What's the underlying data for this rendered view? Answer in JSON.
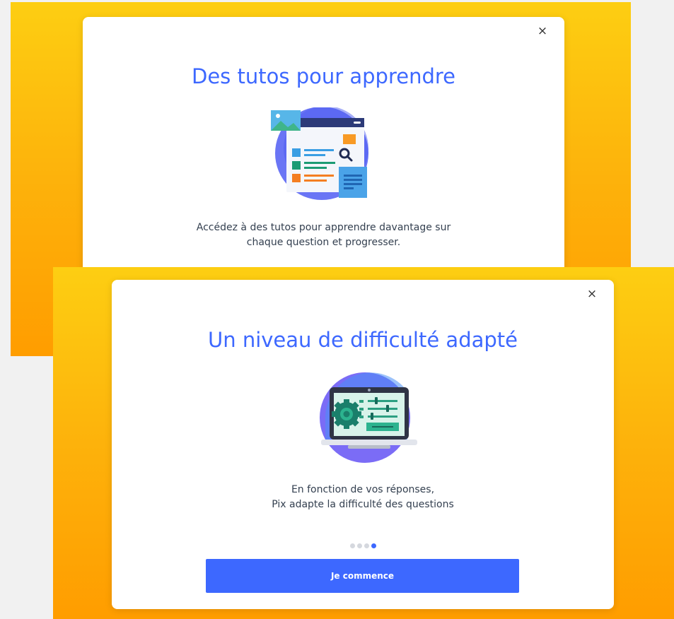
{
  "modal_back": {
    "close_label": "×",
    "title": "Des tutos pour apprendre",
    "illustration_icon": "tutorial-search-illustration",
    "text_lines": [
      "Accédez à des tutos pour apprendre davantage sur",
      "chaque question et progresser."
    ]
  },
  "modal_front": {
    "close_label": "×",
    "title": "Un niveau de difficulté adapté",
    "illustration_icon": "laptop-settings-illustration",
    "text_lines": [
      "En fonction de vos réponses,",
      "Pix adapte la difficulté des questions"
    ],
    "pagination": {
      "total": 4,
      "current": 4
    },
    "button_label": "Je commence"
  },
  "colors": {
    "accent": "#3d68ff",
    "background_gradient_top": "#fdce12",
    "background_gradient_bottom": "#ff9d00",
    "dot_inactive": "#d5d8de"
  }
}
